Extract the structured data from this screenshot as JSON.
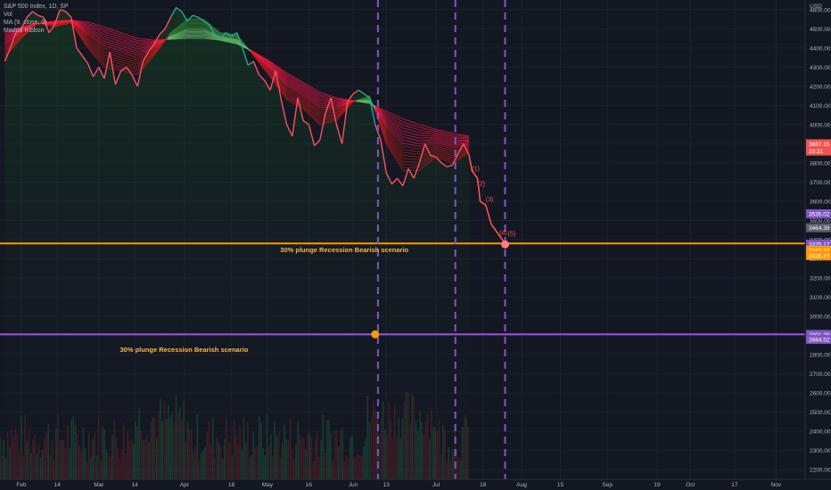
{
  "legend": {
    "symbol": "S&P 500 Index, 1D, SP",
    "volume": "Vol",
    "ma": "MA (9, close, 0)",
    "ribbon": "Madrid Ribbon"
  },
  "chart_data": {
    "type": "line",
    "axis_unit": "USD",
    "ylim": [
      2150,
      4650
    ],
    "y_ticks": [
      2200,
      2300,
      2400,
      2500,
      2600,
      2700,
      2800,
      2900,
      3000,
      3100,
      3200,
      3300,
      3400,
      3500,
      3600,
      3700,
      3800,
      3900,
      4000,
      4100,
      4200,
      4300,
      4400,
      4500,
      4600
    ],
    "x_ticks": [
      {
        "label": "Feb",
        "d": 0
      },
      {
        "label": "14",
        "d": 13
      },
      {
        "label": "Mar",
        "d": 28
      },
      {
        "label": "14",
        "d": 41
      },
      {
        "label": "Apr",
        "d": 59
      },
      {
        "label": "18",
        "d": 76
      },
      {
        "label": "May",
        "d": 89
      },
      {
        "label": "16",
        "d": 104
      },
      {
        "label": "Jun",
        "d": 120
      },
      {
        "label": "13",
        "d": 132
      },
      {
        "label": "Jul",
        "d": 150
      },
      {
        "label": "18",
        "d": 167
      },
      {
        "label": "Aug",
        "d": 181
      },
      {
        "label": "15",
        "d": 195
      },
      {
        "label": "Sep",
        "d": 212
      },
      {
        "label": "19",
        "d": 230
      },
      {
        "label": "Oct",
        "d": 242
      },
      {
        "label": "17",
        "d": 258
      },
      {
        "label": "Nov",
        "d": 273
      }
    ],
    "price": [
      [
        -6,
        4330
      ],
      [
        -4,
        4400
      ],
      [
        -2,
        4480
      ],
      [
        0,
        4500
      ],
      [
        2,
        4560
      ],
      [
        4,
        4590
      ],
      [
        6,
        4570
      ],
      [
        8,
        4560
      ],
      [
        10,
        4480
      ],
      [
        12,
        4520
      ],
      [
        14,
        4600
      ],
      [
        16,
        4590
      ],
      [
        18,
        4560
      ],
      [
        20,
        4400
      ],
      [
        22,
        4360
      ],
      [
        24,
        4320
      ],
      [
        26,
        4250
      ],
      [
        28,
        4300
      ],
      [
        30,
        4240
      ],
      [
        32,
        4380
      ],
      [
        34,
        4210
      ],
      [
        36,
        4280
      ],
      [
        38,
        4300
      ],
      [
        40,
        4260
      ],
      [
        42,
        4200
      ],
      [
        44,
        4330
      ],
      [
        46,
        4380
      ],
      [
        48,
        4420
      ],
      [
        50,
        4470
      ],
      [
        52,
        4500
      ],
      [
        54,
        4560
      ],
      [
        56,
        4610
      ],
      [
        58,
        4590
      ],
      [
        60,
        4540
      ],
      [
        62,
        4570
      ],
      [
        64,
        4560
      ],
      [
        66,
        4540
      ],
      [
        68,
        4520
      ],
      [
        70,
        4470
      ],
      [
        72,
        4450
      ],
      [
        74,
        4480
      ],
      [
        76,
        4460
      ],
      [
        78,
        4480
      ],
      [
        80,
        4400
      ],
      [
        82,
        4310
      ],
      [
        84,
        4330
      ],
      [
        86,
        4260
      ],
      [
        88,
        4230
      ],
      [
        90,
        4180
      ],
      [
        92,
        4280
      ],
      [
        94,
        4130
      ],
      [
        96,
        4000
      ],
      [
        98,
        3940
      ],
      [
        100,
        4140
      ],
      [
        102,
        4020
      ],
      [
        104,
        4000
      ],
      [
        106,
        3890
      ],
      [
        108,
        3920
      ],
      [
        110,
        4060
      ],
      [
        112,
        4140
      ],
      [
        114,
        4000
      ],
      [
        116,
        3900
      ],
      [
        118,
        4120
      ],
      [
        120,
        4160
      ],
      [
        122,
        4180
      ],
      [
        124,
        4160
      ],
      [
        126,
        4140
      ],
      [
        128,
        4000
      ],
      [
        130,
        3920
      ],
      [
        132,
        3750
      ],
      [
        134,
        3690
      ],
      [
        136,
        3720
      ],
      [
        138,
        3680
      ],
      [
        140,
        3770
      ],
      [
        142,
        3720
      ],
      [
        144,
        3800
      ],
      [
        146,
        3900
      ],
      [
        148,
        3840
      ],
      [
        150,
        3830
      ],
      [
        152,
        3800
      ],
      [
        154,
        3780
      ],
      [
        156,
        3790
      ],
      [
        158,
        3850
      ],
      [
        160,
        3900
      ],
      [
        162,
        3840
      ]
    ],
    "projection": [
      [
        162,
        3840
      ],
      [
        163,
        3760
      ],
      [
        165,
        3720
      ],
      [
        166,
        3600
      ],
      [
        168,
        3580
      ],
      [
        170,
        3480
      ],
      [
        172,
        3440
      ],
      [
        174,
        3400
      ],
      [
        175,
        3375
      ]
    ],
    "ribbon_fast": [
      [
        -6,
        4350
      ],
      [
        0,
        4450
      ],
      [
        6,
        4530
      ],
      [
        12,
        4510
      ],
      [
        18,
        4530
      ],
      [
        24,
        4400
      ],
      [
        30,
        4300
      ],
      [
        36,
        4280
      ],
      [
        42,
        4260
      ],
      [
        48,
        4360
      ],
      [
        54,
        4480
      ],
      [
        60,
        4550
      ],
      [
        66,
        4550
      ],
      [
        72,
        4480
      ],
      [
        78,
        4470
      ],
      [
        84,
        4360
      ],
      [
        90,
        4250
      ],
      [
        96,
        4130
      ],
      [
        102,
        4080
      ],
      [
        108,
        4000
      ],
      [
        114,
        4020
      ],
      [
        120,
        4120
      ],
      [
        126,
        4150
      ],
      [
        132,
        3900
      ],
      [
        138,
        3760
      ],
      [
        144,
        3760
      ],
      [
        150,
        3830
      ],
      [
        156,
        3800
      ],
      [
        162,
        3850
      ]
    ],
    "ribbon_slow": [
      [
        -6,
        4480
      ],
      [
        0,
        4510
      ],
      [
        6,
        4530
      ],
      [
        12,
        4540
      ],
      [
        18,
        4545
      ],
      [
        24,
        4535
      ],
      [
        30,
        4510
      ],
      [
        36,
        4480
      ],
      [
        42,
        4450
      ],
      [
        48,
        4440
      ],
      [
        54,
        4445
      ],
      [
        60,
        4450
      ],
      [
        66,
        4450
      ],
      [
        72,
        4440
      ],
      [
        78,
        4420
      ],
      [
        84,
        4380
      ],
      [
        90,
        4330
      ],
      [
        96,
        4270
      ],
      [
        102,
        4220
      ],
      [
        108,
        4170
      ],
      [
        114,
        4140
      ],
      [
        120,
        4125
      ],
      [
        126,
        4110
      ],
      [
        132,
        4070
      ],
      [
        138,
        4030
      ],
      [
        144,
        4000
      ],
      [
        150,
        3975
      ],
      [
        156,
        3955
      ],
      [
        162,
        3940
      ]
    ],
    "wave_labels": [
      {
        "text": "(1)",
        "d": 163,
        "v": 3760
      },
      {
        "text": "(2)",
        "d": 165,
        "v": 3680
      },
      {
        "text": "(3)",
        "d": 168,
        "v": 3600
      },
      {
        "text": "(4)",
        "d": 173,
        "v": 3425
      },
      {
        "text": "(5)",
        "d": 176,
        "v": 3420
      }
    ],
    "points": [
      {
        "d": 175,
        "v": 3375,
        "color": "#ff7c7c"
      },
      {
        "d": 128,
        "v": 2906,
        "color": "#ff9800"
      }
    ],
    "hlines": [
      {
        "v": 3380,
        "color": "#ff9800"
      },
      {
        "v": 2906,
        "color": "#9c51e0"
      }
    ],
    "vlines": [
      129,
      157,
      175
    ],
    "annotations": [
      {
        "text": "30% plunge Recession Bearish scenario",
        "d": 113,
        "v": 3340
      },
      {
        "text": "30% plunge Recession Bearish scenario",
        "d": 55,
        "v": 2820
      }
    ],
    "price_tags": [
      {
        "text": "3887.15",
        "v": 3900,
        "bg": "#ef5350"
      },
      {
        "text": "33:31",
        "v": 3862,
        "bg": "#ef5350"
      },
      {
        "text": "3535.02",
        "v": 3535,
        "bg": "#7e57c2"
      },
      {
        "text": "3464.39",
        "v": 3462,
        "bg": "#5b5f6b"
      },
      {
        "text": "3375.17",
        "v": 3377,
        "bg": "#7e57c2"
      },
      {
        "text": "3347.34",
        "v": 3344,
        "bg": "#ff9800"
      },
      {
        "text": "3336.27",
        "v": 3317,
        "bg": "#ff9800"
      },
      {
        "text": "2901.29",
        "v": 2906,
        "bg": "#7e57c2"
      },
      {
        "text": "2884.52",
        "v": 2880,
        "bg": "#7e57c2"
      }
    ]
  }
}
